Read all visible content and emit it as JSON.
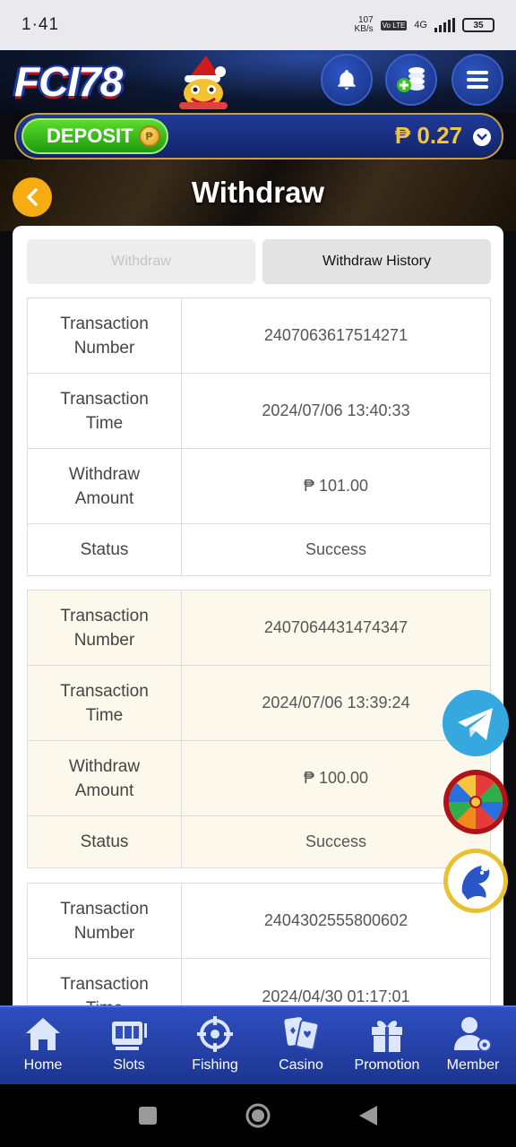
{
  "status_bar": {
    "time": "1·41",
    "net_speed": "107",
    "net_speed_unit": "KB/s",
    "volte": "Vo LTE",
    "network": "4G",
    "battery": "35"
  },
  "header": {
    "logo": "FCI78",
    "icons": [
      "bell-icon",
      "coin-stack-icon",
      "menu-icon"
    ]
  },
  "deposit_bar": {
    "deposit_label": "DEPOSIT",
    "balance": "₱ 0.27"
  },
  "page": {
    "title": "Withdraw"
  },
  "tabs": [
    {
      "label": "Withdraw",
      "active": false
    },
    {
      "label": "Withdraw History",
      "active": true
    }
  ],
  "records": [
    {
      "labels": {
        "number": "Transaction Number",
        "time": "Transaction Time",
        "amount": "Withdraw Amount",
        "status": "Status"
      },
      "number": "2407063617514271",
      "time": "2024/07/06 13:40:33",
      "amount": "₱ 101.00",
      "status": "Success"
    },
    {
      "labels": {
        "number": "Transaction Number",
        "time": "Transaction Time",
        "amount": "Withdraw Amount",
        "status": "Status"
      },
      "number": "2407064431474347",
      "time": "2024/07/06 13:39:24",
      "amount": "₱ 100.00",
      "status": "Success"
    },
    {
      "labels": {
        "number": "Transaction Number",
        "time": "Transaction Time"
      },
      "number": "2404302555800602",
      "time": "2024/04/30 01:17:01"
    }
  ],
  "bottom_nav": [
    {
      "label": "Home",
      "icon": "home-icon"
    },
    {
      "label": "Slots",
      "icon": "slots-icon"
    },
    {
      "label": "Fishing",
      "icon": "crosshair-icon"
    },
    {
      "label": "Casino",
      "icon": "cards-icon"
    },
    {
      "label": "Promotion",
      "icon": "gift-icon"
    },
    {
      "label": "Member",
      "icon": "member-icon"
    }
  ],
  "colors": {
    "nav_blue": "#2f4fc0",
    "deposit_green": "#3cc21e",
    "balance_gold": "#f4c53e",
    "back_orange": "#f7ad12",
    "alt_row": "#fdf8ec"
  }
}
